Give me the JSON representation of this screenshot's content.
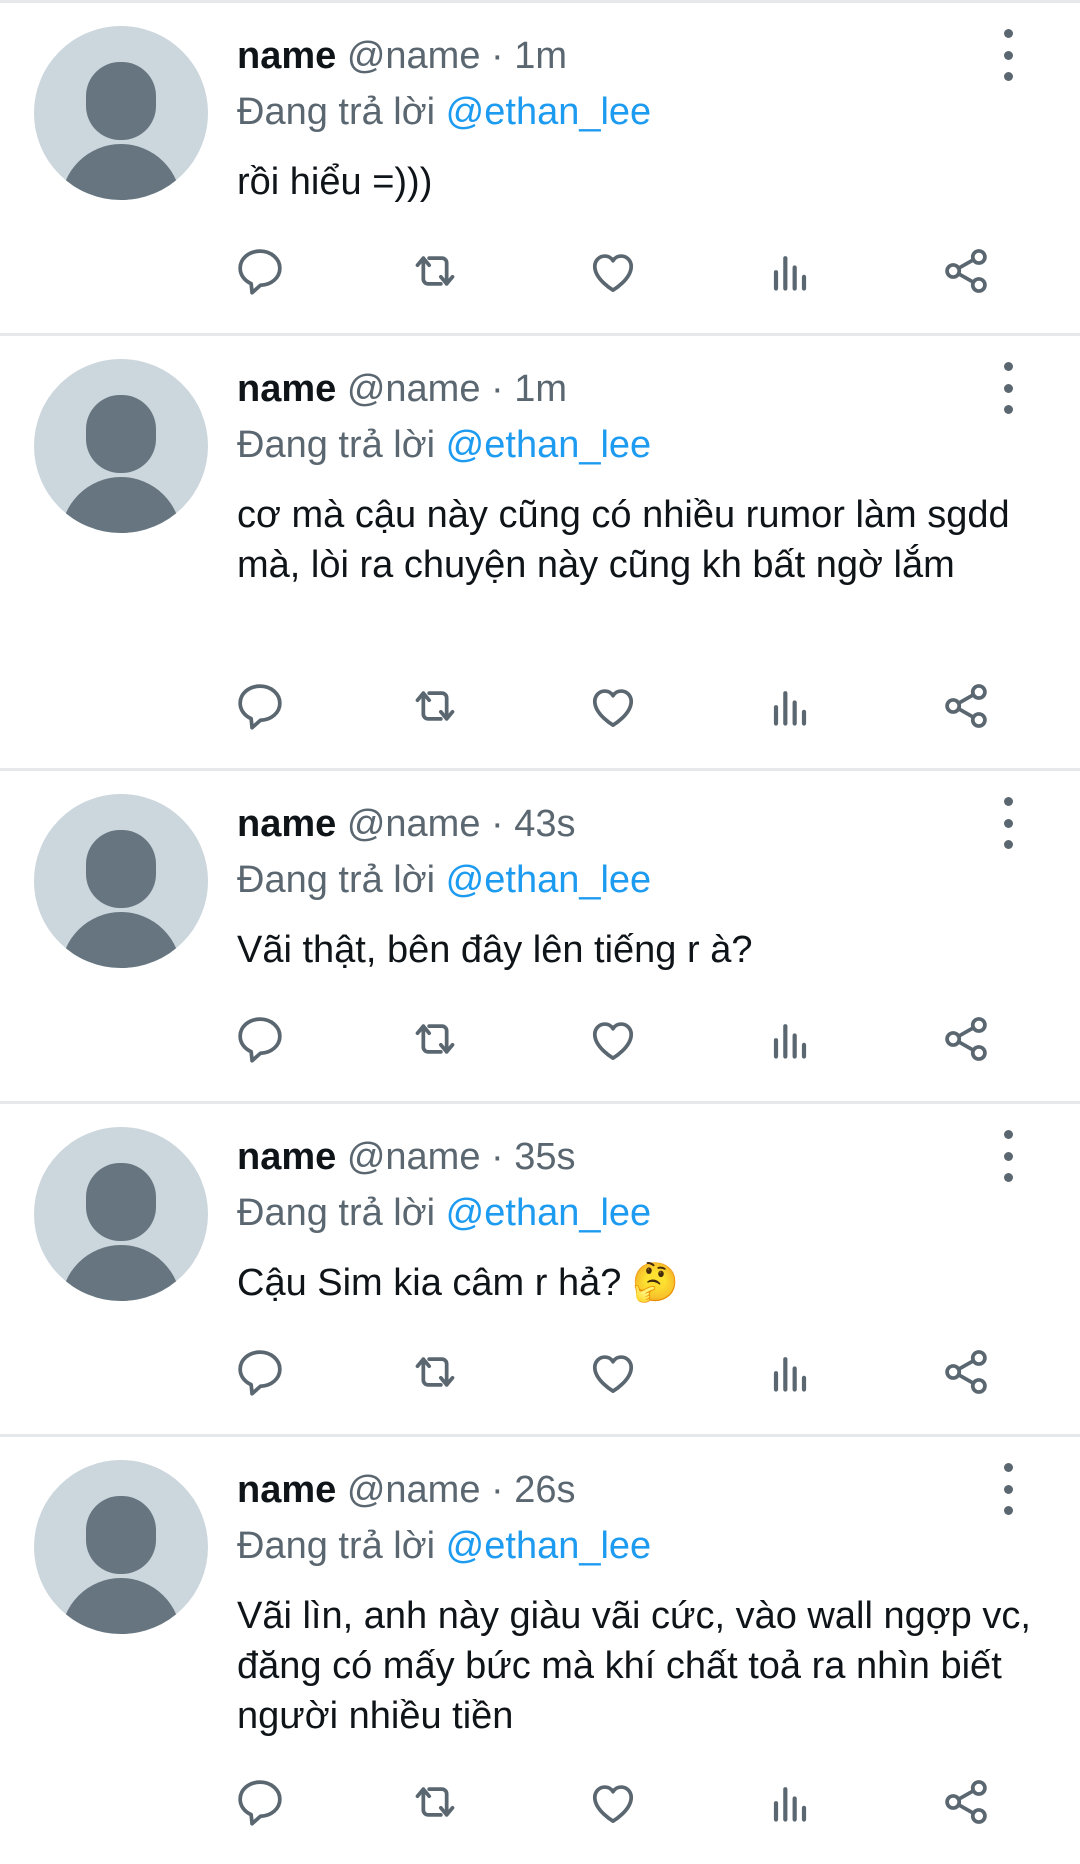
{
  "tweets": [
    {
      "display_name": "name",
      "handle": "@name",
      "separator": "·",
      "time": "1m",
      "replying_label": "Đang trả lời",
      "replying_to": "@ethan_lee",
      "text": "rồi hiểu =)))"
    },
    {
      "display_name": "name",
      "handle": "@name",
      "separator": "·",
      "time": "1m",
      "replying_label": "Đang trả lời",
      "replying_to": "@ethan_lee",
      "text": "cơ mà cậu này cũng có nhiều rumor làm sgdd mà, lòi ra chuyện này cũng kh bất ngờ lắm"
    },
    {
      "display_name": "name",
      "handle": "@name",
      "separator": "·",
      "time": "43s",
      "replying_label": "Đang trả lời",
      "replying_to": "@ethan_lee",
      "text": "Vãi thật, bên đây lên tiếng r à?"
    },
    {
      "display_name": "name",
      "handle": "@name",
      "separator": "·",
      "time": "35s",
      "replying_label": "Đang trả lời",
      "replying_to": "@ethan_lee",
      "text": "Cậu Sim kia câm r hả? 🤔"
    },
    {
      "display_name": "name",
      "handle": "@name",
      "separator": "·",
      "time": "26s",
      "replying_label": "Đang trả lời",
      "replying_to": "@ethan_lee",
      "text": "Vãi lìn, anh này giàu vãi cức, vào wall ngợp vc, đăng có mấy bức mà khí chất toả ra nhìn biết người nhiều tiền"
    }
  ],
  "action_icons": [
    "reply-icon",
    "retweet-icon",
    "like-icon",
    "analytics-icon",
    "share-icon"
  ],
  "colors": {
    "mention": "#1d9bf0",
    "secondary_text": "#5b6770",
    "primary_text": "#0f1419",
    "avatar_bg": "#ccd6dd",
    "avatar_fg": "#66757f",
    "divider": "#e6e9eb"
  }
}
